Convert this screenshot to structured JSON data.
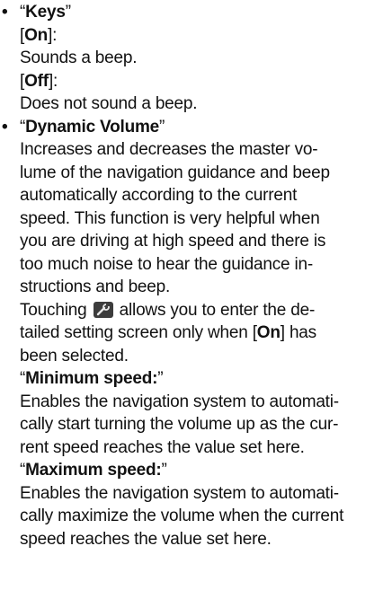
{
  "keys": {
    "bullet": "•",
    "open_quote": "“",
    "title": "Keys",
    "close_quote": "”",
    "on_label": "On",
    "on_desc": "Sounds a beep.",
    "off_label": "Off",
    "off_desc": "Does not sound a beep."
  },
  "dynamic_volume": {
    "bullet": "•",
    "open_quote": "“",
    "title": "Dynamic Volume",
    "close_quote": "”",
    "desc_lines": [
      "Increases and decreases the master vo-",
      "lume of the navigation guidance and beep",
      "automatically according to the current",
      "speed. This function is very helpful when",
      "you are driving at high speed and there is",
      "too much noise to hear the guidance in-",
      "structions and beep."
    ],
    "touch_before": "Touching",
    "touch_after": "allows you to enter the de-",
    "touch_line2_before": "tailed setting screen only when [",
    "touch_on_label": "On",
    "touch_line2_after": "] has",
    "touch_line3": "been selected.",
    "wrench_icon": "wrench-icon"
  },
  "minimum_speed": {
    "open_quote": "“",
    "title": "Minimum speed:",
    "close_quote": "”",
    "desc_lines": [
      "Enables the navigation system to automati-",
      "cally start turning the volume up as the cur-",
      "rent speed reaches the value set here."
    ]
  },
  "maximum_speed": {
    "open_quote": "“",
    "title": "Maximum speed:",
    "close_quote": "”",
    "desc_lines": [
      "Enables the navigation system to automati-",
      "cally maximize the volume when the current",
      "speed reaches the value set here."
    ]
  }
}
